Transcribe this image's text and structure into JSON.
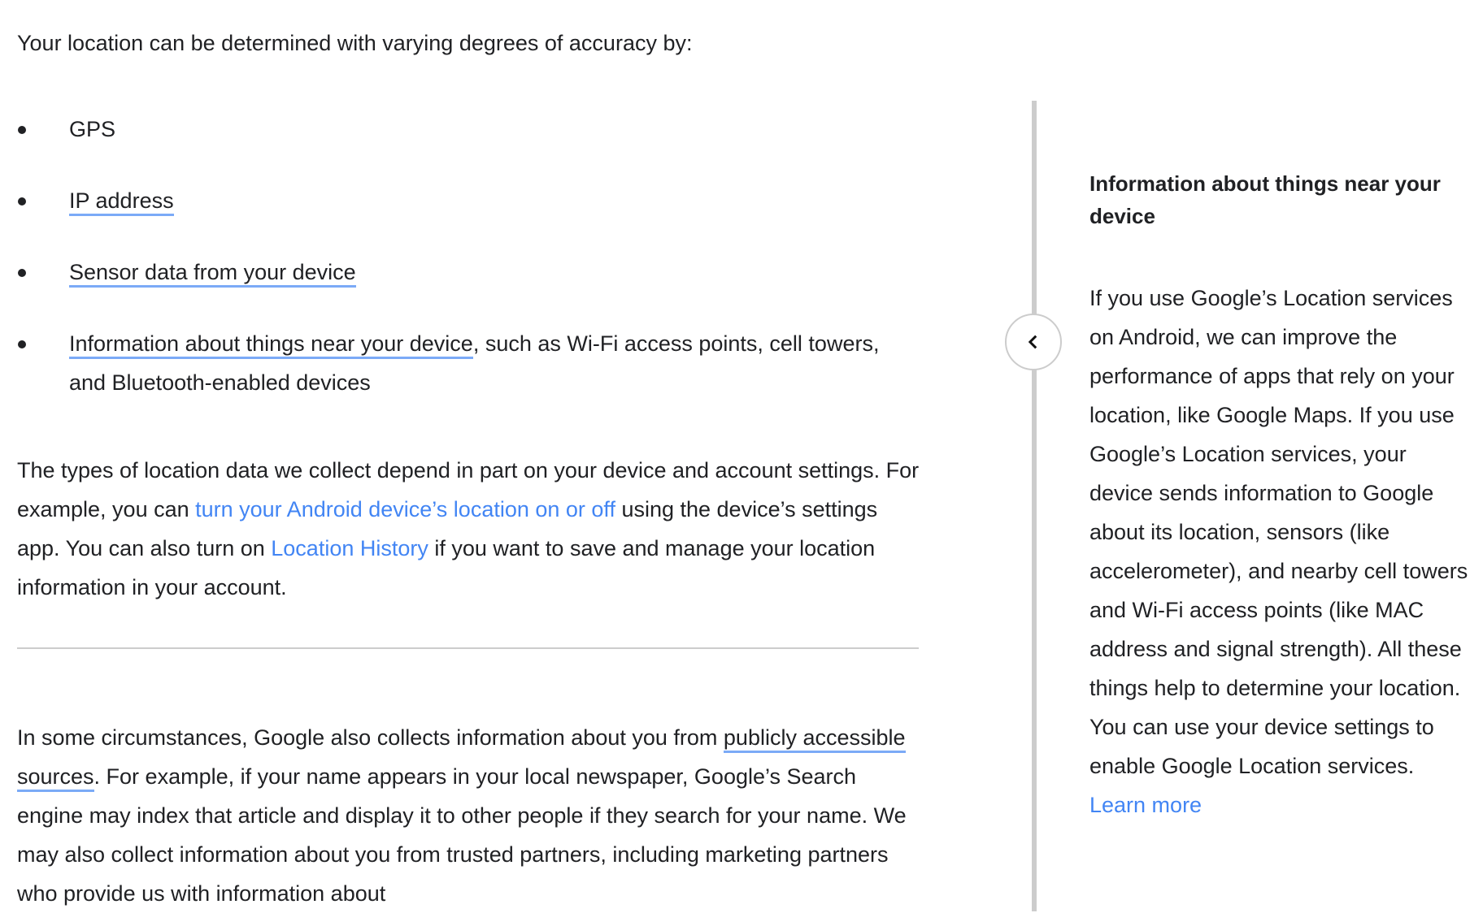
{
  "main": {
    "intro": "Your location can be determined with varying degrees of accuracy by:",
    "list": [
      {
        "text": "GPS"
      },
      {
        "link": "IP address"
      },
      {
        "link": "Sensor data from your device"
      },
      {
        "link": "Information about things near your device",
        "after": ", such as Wi-Fi access points, cell towers, and Bluetooth-enabled devices"
      }
    ],
    "para1": {
      "t1": "The types of location data we collect depend in part on your device and account settings. For example, you can ",
      "link1": "turn your Android device’s location on or off",
      "t2": " using the device’s settings app. You can also turn on ",
      "link2": "Location History",
      "t3": " if you want to save and manage your location information in your account."
    },
    "para3": {
      "t1": "In some circumstances, Google also collects information about you from ",
      "link1": "publicly accessible sources",
      "t2": ". For example, if your name appears in your local newspaper, Google’s Search engine may index that article and display it to other people if they search for your name. We may also collect information about you from trusted partners, including marketing partners who provide us with information about"
    }
  },
  "aside": {
    "collapse_icon": "chevron-left-icon",
    "title": "Information about things near your device",
    "body": "If you use Google’s Location services on Android, we can improve the performance of apps that rely on your location, like Google Maps. If you use Google’s Location services, your device sends information to Google about its location, sensors (like accelerometer), and nearby cell towers and Wi-Fi access points (like MAC address and signal strength). All these things help to determine your location. You can use your device settings to enable Google Location services. ",
    "link": "Learn more"
  },
  "colors": {
    "text": "#202124",
    "link": "#4285f4",
    "glossary_underline": "#7baaf7",
    "divider": "#cccccc"
  }
}
